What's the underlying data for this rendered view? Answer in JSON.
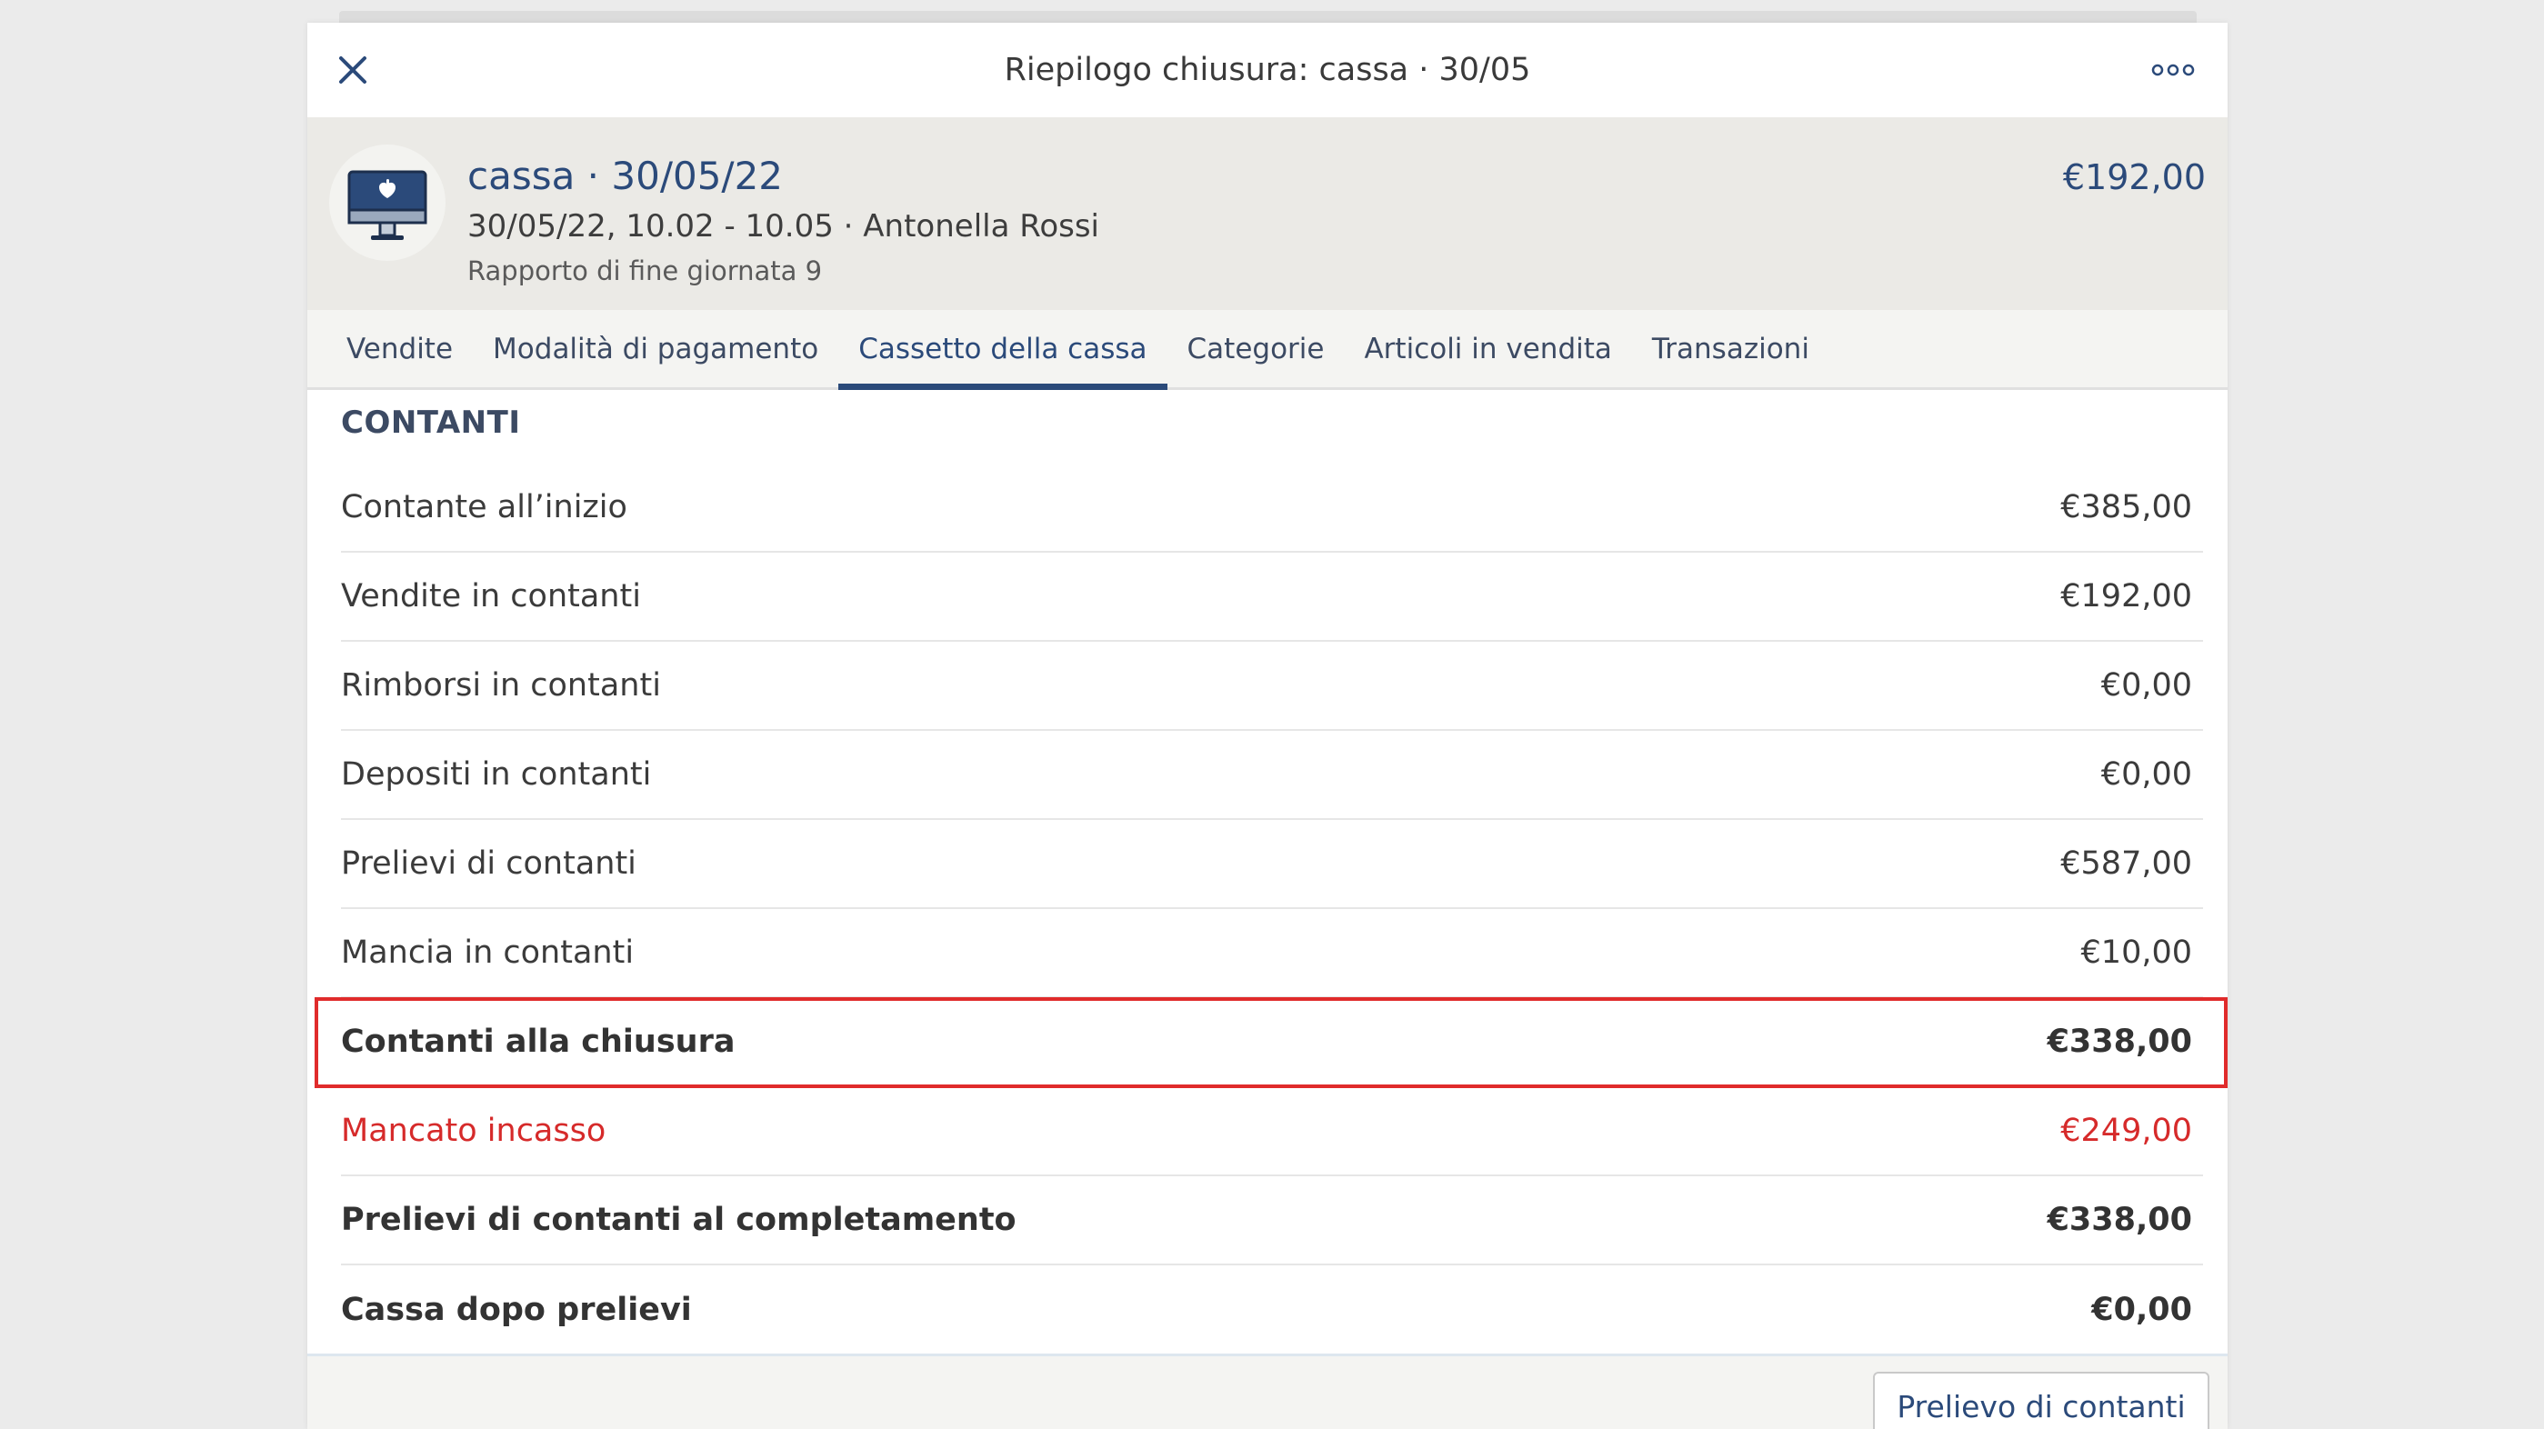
{
  "modal": {
    "title": "Riepilogo chiusura: cassa · 30/05"
  },
  "header": {
    "title": "cassa · 30/05/22",
    "subtitle": "30/05/22, 10.02 - 10.05 · Antonella Rossi",
    "report": "Rapporto di fine giornata 9",
    "amount": "€192,00",
    "icon": "desktop-computer-icon"
  },
  "tabs": [
    {
      "label": "Vendite"
    },
    {
      "label": "Modalità di pagamento"
    },
    {
      "label": "Cassetto della cassa",
      "active": true
    },
    {
      "label": "Categorie"
    },
    {
      "label": "Articoli in vendita"
    },
    {
      "label": "Transazioni"
    }
  ],
  "section": {
    "heading": "CONTANTI",
    "rows": [
      {
        "label": "Contante all’inizio",
        "value": "€385,00"
      },
      {
        "label": "Vendite in contanti",
        "value": "€192,00"
      },
      {
        "label": "Rimborsi in contanti",
        "value": "€0,00"
      },
      {
        "label": "Depositi in contanti",
        "value": "€0,00"
      },
      {
        "label": "Prelievi di contanti",
        "value": "€587,00"
      },
      {
        "label": "Mancia in contanti",
        "value": "€10,00"
      },
      {
        "label": "Contanti alla chiusura",
        "value": "€338,00",
        "style": "bold",
        "highlighted": true
      },
      {
        "label": "Mancato incasso",
        "value": "€249,00",
        "style": "alert"
      },
      {
        "label": "Prelievi di contanti al completamento",
        "value": "€338,00",
        "style": "bold"
      },
      {
        "label": "Cassa dopo prelievi",
        "value": "€0,00",
        "style": "bold"
      }
    ]
  },
  "footer": {
    "button_label": "Prelievo di contanti"
  },
  "colors": {
    "accent": "#2b4a7a",
    "alert": "#d62a2a",
    "highlight_border": "#e02b2b",
    "header_bg": "#ebeae6"
  }
}
